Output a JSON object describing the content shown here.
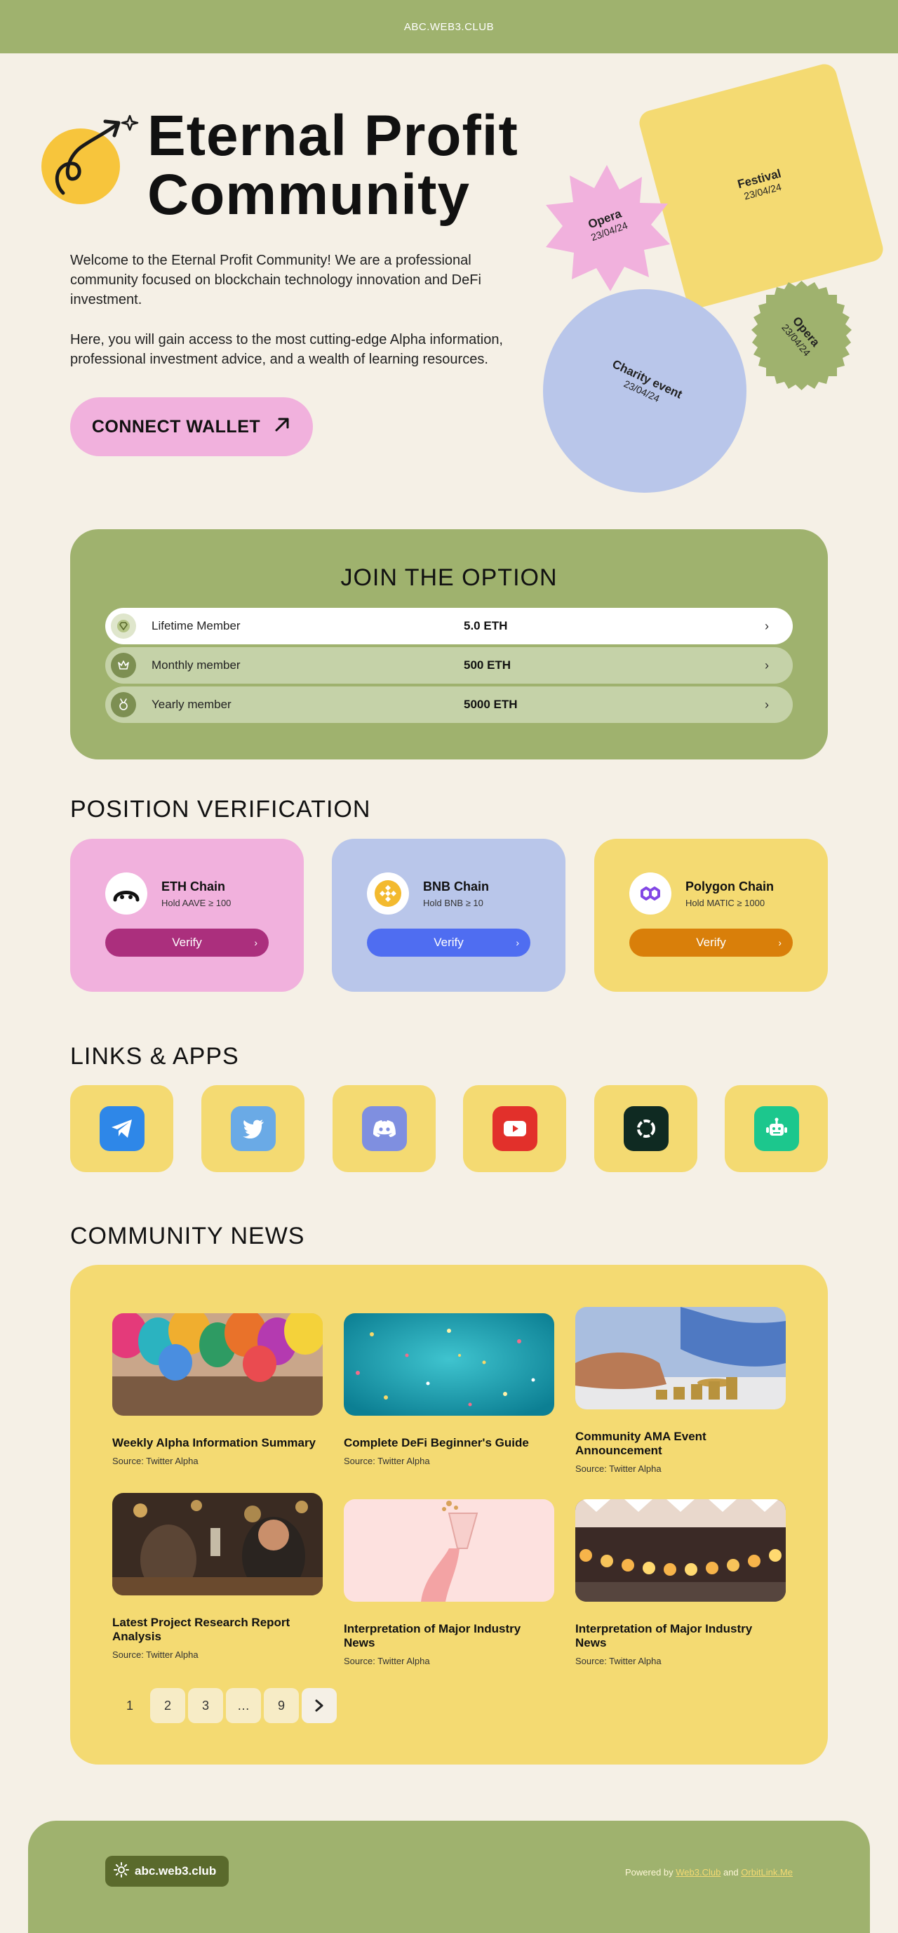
{
  "header": {
    "site_name": "ABC.WEB3.CLUB"
  },
  "hero": {
    "title_line1": "Eternal Profit",
    "title_line2": "Community",
    "paragraph1": "Welcome to the Eternal Profit Community! We are a professional community focused on blockchain technology innovation and DeFi investment.",
    "paragraph2": "Here, you will gain access to the most cutting-edge Alpha information, professional investment advice, and a wealth of learning resources.",
    "connect_label": "CONNECT WALLET",
    "logo_icon": "arrow-up-right-swirl-icon",
    "connect_icon": "arrow-up-right-icon"
  },
  "events": [
    {
      "name": "Festival",
      "date": "23/04/24",
      "color": "#f4da72",
      "shape": "rounded-square"
    },
    {
      "name": "Opera",
      "date": "23/04/24",
      "color": "#f1b1dd",
      "shape": "star"
    },
    {
      "name": "Charity event",
      "date": "23/04/24",
      "color": "#b9c6ea",
      "shape": "circle"
    },
    {
      "name": "Opera",
      "date": "23/04/24",
      "color": "#9fb26e",
      "shape": "scalloped-circle"
    }
  ],
  "join": {
    "title": "JOIN THE OPTION",
    "options": [
      {
        "name": "Lifetime Member",
        "price": "5.0 ETH",
        "icon": "diamond-badge-icon",
        "active": true
      },
      {
        "name": "Monthly member",
        "price": "500 ETH",
        "icon": "crown-icon",
        "active": false
      },
      {
        "name": "Yearly member",
        "price": "5000 ETH",
        "icon": "medal-icon",
        "active": false
      }
    ]
  },
  "verification": {
    "title": "POSITION VERIFICATION",
    "chains": [
      {
        "name": "ETH Chain",
        "requirement": "Hold AAVE ≥ 100",
        "button": "Verify",
        "card_color": "#f1b1dd",
        "button_color": "#ab2f7d",
        "icon": "aave-icon"
      },
      {
        "name": "BNB Chain",
        "requirement": "Hold BNB ≥ 10",
        "button": "Verify",
        "card_color": "#b9c6ea",
        "button_color": "#4f6df1",
        "icon": "bnb-icon"
      },
      {
        "name": "Polygon Chain",
        "requirement": "Hold MATIC ≥ 1000",
        "button": "Verify",
        "card_color": "#f4da72",
        "button_color": "#d97f0a",
        "icon": "polygon-icon"
      }
    ]
  },
  "links": {
    "title": "LINKS & APPS",
    "apps": [
      {
        "icon": "telegram-icon",
        "color": "#2e87e8"
      },
      {
        "icon": "twitter-icon",
        "color": "#6aaae6"
      },
      {
        "icon": "discord-icon",
        "color": "#7f8fe0"
      },
      {
        "icon": "youtube-icon",
        "color": "#e2302b"
      },
      {
        "icon": "ring-app-icon",
        "color": "#0f2a22"
      },
      {
        "icon": "robot-icon",
        "color": "#1cc78d"
      }
    ]
  },
  "news": {
    "title": "COMMUNITY NEWS",
    "items": [
      {
        "title": "Weekly Alpha Information Summary",
        "source": "Source: Twitter Alpha",
        "image": "balloons-photo"
      },
      {
        "title": "Complete DeFi Beginner's Guide",
        "source": "Source: Twitter Alpha",
        "image": "confetti-photo"
      },
      {
        "title": "Community AMA Event Announcement",
        "source": "Source: Twitter Alpha",
        "image": "coins-stacking-photo"
      },
      {
        "title": "Latest Project Research Report Analysis",
        "source": "Source: Twitter Alpha",
        "image": "party-toast-photo"
      },
      {
        "title": "Interpretation of Major Industry News",
        "source": "Source: Twitter Alpha",
        "image": "champagne-glass-photo"
      },
      {
        "title": "Interpretation of Major Industry News",
        "source": "Source: Twitter Alpha",
        "image": "string-lights-photo"
      }
    ],
    "pagination": {
      "pages": [
        "1",
        "2",
        "3",
        "…",
        "9"
      ],
      "current": "1",
      "next_icon": "chevron-right-icon"
    }
  },
  "footer": {
    "brand": "abc.web3.club",
    "brand_icon": "gear-icon",
    "powered_prefix": "Powered by",
    "link1": "Web3.Club",
    "and": "and",
    "link2": "OrbitLink.Me"
  }
}
